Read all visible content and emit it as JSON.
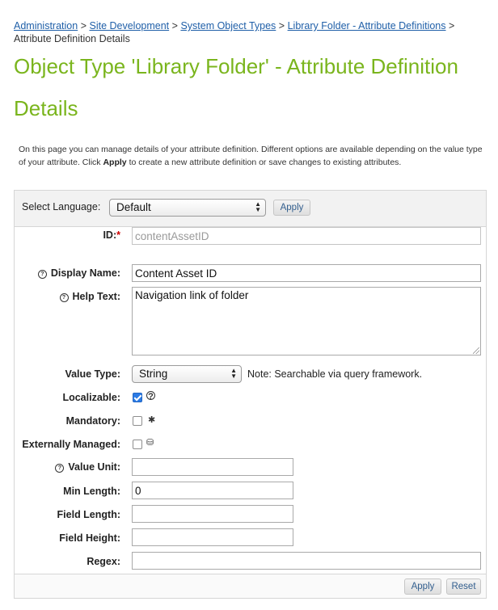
{
  "breadcrumb": {
    "items": [
      "Administration",
      "Site Development",
      "System Object Types",
      "Library Folder - Attribute Definitions"
    ],
    "current": "Attribute Definition Details",
    "separator": ">"
  },
  "page_title": "Object Type 'Library Folder' - Attribute Definition Details",
  "intro": {
    "part1": "On this page you can manage details of your attribute definition. Different options are available depending on the value type of your attribute. Click",
    "bold": "Apply",
    "part2": "to create a new attribute definition or save changes to existing attributes."
  },
  "language": {
    "label": "Select Language:",
    "selected": "Default",
    "apply_label": "Apply"
  },
  "form": {
    "id": {
      "label": "ID:",
      "required_mark": "*",
      "value": "contentAssetID"
    },
    "display_name": {
      "label": "Display Name:",
      "value": "Content Asset ID"
    },
    "help_text": {
      "label": "Help Text:",
      "value": "Navigation link of folder"
    },
    "value_type": {
      "label": "Value Type:",
      "selected": "String",
      "note": "Note: Searchable via query framework."
    },
    "localizable": {
      "label": "Localizable:",
      "checked": true
    },
    "mandatory": {
      "label": "Mandatory:",
      "checked": false
    },
    "externally_managed": {
      "label": "Externally Managed:",
      "checked": false
    },
    "value_unit": {
      "label": "Value Unit:",
      "value": ""
    },
    "min_length": {
      "label": "Min Length:",
      "value": "0"
    },
    "field_length": {
      "label": "Field Length:",
      "value": ""
    },
    "field_height": {
      "label": "Field Height:",
      "value": ""
    },
    "regex": {
      "label": "Regex:",
      "value": ""
    }
  },
  "footer": {
    "apply_label": "Apply",
    "reset_label": "Reset"
  },
  "colors": {
    "title": "#7ab51d",
    "link": "#1f5fa8",
    "required": "#cc0000",
    "checkbox": "#2c7be5"
  },
  "icons": {
    "info": "info-circle-icon",
    "asterisk": "asterisk-icon",
    "external": "external-managed-icon"
  }
}
